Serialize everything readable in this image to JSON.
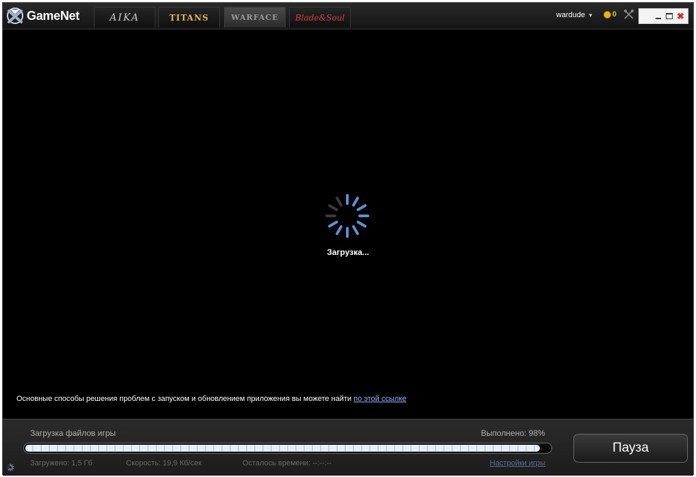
{
  "app": {
    "name": "GameNet"
  },
  "tabs": [
    {
      "label": "AIKA"
    },
    {
      "label": "TITANS"
    },
    {
      "label": "WARFACE"
    },
    {
      "label": "Blade&Soul"
    }
  ],
  "header": {
    "username": "wardude",
    "coins": "0"
  },
  "main": {
    "loading_text": "Загрузка...",
    "help_text": "Основные способы решения проблем с запуском и обновлением приложения вы можете найти",
    "help_link": "по этой ссылке"
  },
  "footer": {
    "download_label": "Загрузка файлов игры",
    "done_label": "Выполнено: 98%",
    "progress_percent": 98,
    "downloaded": "Загружено: 1,5 Гб",
    "speed": "Скорость: 19,9 Кб/сек",
    "time_left": "Осталось времени: --:--:--",
    "settings_link": "Настройки игры",
    "pause_button": "Пауза"
  },
  "colors": {
    "accent": "#5b8fd6",
    "link": "#8fb4ff",
    "coin": "#e8b818"
  }
}
